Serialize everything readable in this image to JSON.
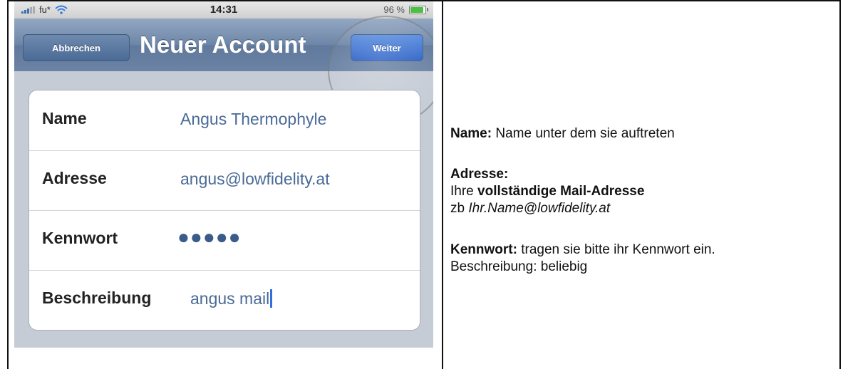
{
  "phone": {
    "status_bar": {
      "carrier": "fu*",
      "time": "14:31",
      "battery": "96 %",
      "battery_level": 0.96
    },
    "navbar": {
      "cancel_label": "Abbrechen",
      "title": "Neuer Account",
      "next_label": "Weiter"
    },
    "form": {
      "rows": [
        {
          "label": "Name",
          "value": "Angus Thermophyle"
        },
        {
          "label": "Adresse",
          "value": "angus@lowfidelity.at"
        },
        {
          "label": "Kennwort",
          "value": "●●●●●"
        },
        {
          "label": "Beschreibung",
          "value": "angus mail"
        }
      ]
    }
  },
  "notes": {
    "name_label": "Name:",
    "name_text": "Name unter dem sie auftreten",
    "address_label": "Adresse:",
    "address_prefix": "Ihre",
    "address_bold": "vollständige Mail-Adresse",
    "address_example_prefix": "zb",
    "address_example": "Ihr.Name@lowfidelity.at",
    "password_label": "Kennwort:",
    "password_text": "tragen sie bitte ihr Kennwort ein.",
    "description_line": "Beschreibung: beliebig"
  },
  "colors": {
    "navbar": "#6d86a8",
    "next_button": "#2a5fc6",
    "field_value": "#4a6a96",
    "cursor": "#2f6fe0"
  },
  "icons": [
    "signal-bars-icon",
    "wifi-icon",
    "battery-icon"
  ]
}
